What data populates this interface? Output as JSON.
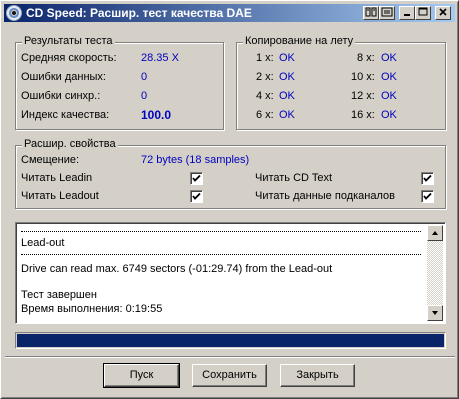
{
  "window": {
    "title": "CD Speed: Расшир. тест качества DAE",
    "controls": [
      "help-icon",
      "minimize-icon",
      "maximize-icon",
      "close-icon"
    ]
  },
  "results": {
    "title": "Результаты теста",
    "rows": [
      {
        "label": "Средняя скорость:",
        "value": "28.35 X"
      },
      {
        "label": "Ошибки данных:",
        "value": "0"
      },
      {
        "label": "Ошибки синхр.:",
        "value": "0"
      },
      {
        "label": "Индекс качества:",
        "value": "100.0"
      }
    ]
  },
  "overburn": {
    "title": "Копирование на лету",
    "left": [
      {
        "label": "1 x:",
        "value": "OK"
      },
      {
        "label": "2 x:",
        "value": "OK"
      },
      {
        "label": "4 x:",
        "value": "OK"
      },
      {
        "label": "6 x:",
        "value": "OK"
      }
    ],
    "right": [
      {
        "label": "8 x:",
        "value": "OK"
      },
      {
        "label": "10 x:",
        "value": "OK"
      },
      {
        "label": "12 x:",
        "value": "OK"
      },
      {
        "label": "16 x:",
        "value": "OK"
      }
    ]
  },
  "advanced": {
    "title": "Расшир. свойства",
    "offset_label": "Смещение:",
    "offset_value": "72 bytes (18 samples)",
    "options": [
      {
        "label": "Читать Leadin",
        "checked": true
      },
      {
        "label": "Читать Leadout",
        "checked": true
      },
      {
        "label": "Читать CD Text",
        "checked": true
      },
      {
        "label": "Читать данные подканалов",
        "checked": true
      }
    ]
  },
  "log": {
    "lines": [
      "Lead-out",
      "Drive can read max. 6749 sectors (-01:29.74) from the Lead-out",
      "Тест завершен",
      "Время выполнения:  0:19:55"
    ]
  },
  "progress": {
    "percent": 100,
    "color": "#0a246a"
  },
  "buttons": {
    "start": "Пуск",
    "save": "Сохранить",
    "close": "Закрыть"
  }
}
